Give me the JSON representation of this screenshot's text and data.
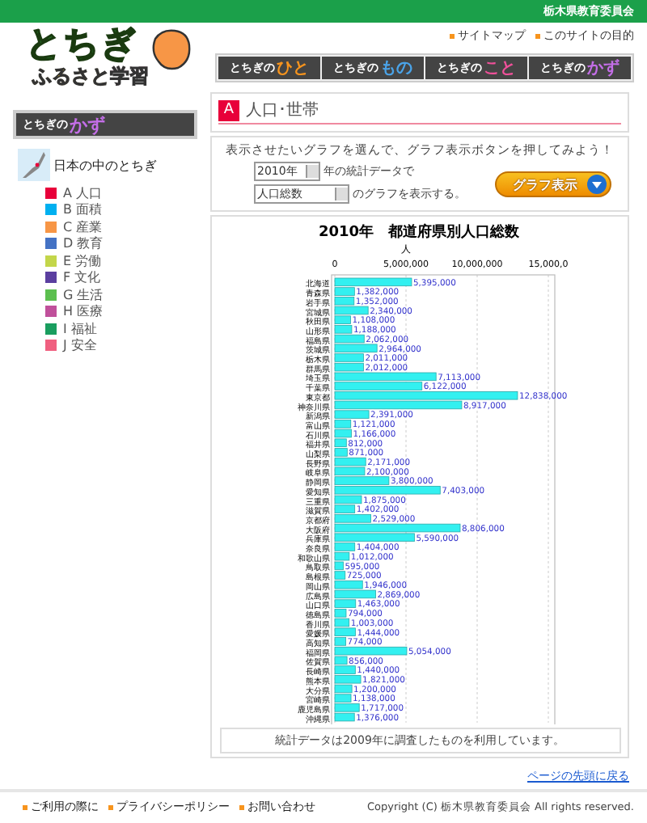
{
  "header": {
    "org": "栃木県教育委員会",
    "logo_top": "とちぎ",
    "logo_bottom_1": "ふるさと",
    "logo_bottom_2": "学習",
    "links": [
      "サイトマップ",
      "このサイトの目的"
    ]
  },
  "nav": [
    {
      "prefix": "とちぎの",
      "word": "ひと"
    },
    {
      "prefix": "とちぎの",
      "word": "もの"
    },
    {
      "prefix": "とちぎの",
      "word": "こと"
    },
    {
      "prefix": "とちぎの",
      "word": "かず"
    }
  ],
  "sidebar": {
    "heading": {
      "prefix": "とちぎの",
      "word": "かず"
    },
    "map_link": "日本の中のとちぎ",
    "categories": [
      {
        "letter": "A",
        "label": "人口",
        "color": "#e8003a"
      },
      {
        "letter": "B",
        "label": "面積",
        "color": "#00b0f0"
      },
      {
        "letter": "C",
        "label": "産業",
        "color": "#f79646"
      },
      {
        "letter": "D",
        "label": "教育",
        "color": "#4472c4"
      },
      {
        "letter": "E",
        "label": "労働",
        "color": "#c3d64a"
      },
      {
        "letter": "F",
        "label": "文化",
        "color": "#5b3fa0"
      },
      {
        "letter": "G",
        "label": "生活",
        "color": "#5cbf4f"
      },
      {
        "letter": "H",
        "label": "医療",
        "color": "#c0509b"
      },
      {
        "letter": "I",
        "label": "福祉",
        "color": "#1a9e5f"
      },
      {
        "letter": "J",
        "label": "安全",
        "color": "#f06080"
      }
    ]
  },
  "section": {
    "letter": "A",
    "title": "人口･世帯",
    "color": "#e8003a"
  },
  "controls": {
    "instruction": "表示させたいグラフを選んで、グラフ表示ボタンを押してみよう！",
    "year": "2010年",
    "year_suffix": "年の統計データで",
    "item": "人口総数",
    "item_suffix": "のグラフを表示する。",
    "button": "グラフ表示"
  },
  "chart_data": {
    "type": "bar",
    "orientation": "horizontal",
    "title": "2010年　都道府県別人口総数",
    "xlabel": "人",
    "data_labels": true,
    "categories": [
      "北海道",
      "青森県",
      "岩手県",
      "宮城県",
      "秋田県",
      "山形県",
      "福島県",
      "茨城県",
      "栃木県",
      "群馬県",
      "埼玉県",
      "千葉県",
      "東京都",
      "神奈川県",
      "新潟県",
      "富山県",
      "石川県",
      "福井県",
      "山梨県",
      "長野県",
      "岐阜県",
      "静岡県",
      "愛知県",
      "三重県",
      "滋賀県",
      "京都府",
      "大阪府",
      "兵庫県",
      "奈良県",
      "和歌山県",
      "鳥取県",
      "島根県",
      "岡山県",
      "広島県",
      "山口県",
      "徳島県",
      "香川県",
      "愛媛県",
      "高知県",
      "福岡県",
      "佐賀県",
      "長崎県",
      "熊本県",
      "大分県",
      "宮崎県",
      "鹿児島県",
      "沖縄県"
    ],
    "values": [
      5395000,
      1382000,
      1352000,
      2340000,
      1108000,
      1188000,
      2062000,
      2964000,
      2011000,
      2012000,
      7113000,
      6122000,
      12838000,
      8917000,
      2391000,
      1121000,
      1166000,
      812000,
      871000,
      2171000,
      2100000,
      3800000,
      7403000,
      1875000,
      1402000,
      2529000,
      8806000,
      5590000,
      1404000,
      1012000,
      595000,
      725000,
      1946000,
      2869000,
      1463000,
      794000,
      1003000,
      1444000,
      774000,
      5054000,
      856000,
      1440000,
      1821000,
      1200000,
      1138000,
      1717000,
      1376000
    ],
    "value_labels": [
      "5,395,000",
      "1,382,000",
      "1,352,000",
      "2,340,000",
      "1,108,000",
      "1,188,000",
      "2,062,000",
      "2,964,000",
      "2,011,000",
      "2,012,000",
      "7,113,000",
      "6,122,000",
      "12,838,000",
      "8,917,000",
      "2,391,000",
      "1,121,000",
      "1,166,000",
      "812,000",
      "871,000",
      "2,171,000",
      "2,100,000",
      "3,800,000",
      "7,403,000",
      "1,875,000",
      "1,402,000",
      "2,529,000",
      "8,806,000",
      "5,590,000",
      "1,404,000",
      "1,012,000",
      "595,000",
      "725,000",
      "1,946,000",
      "2,869,000",
      "1,463,000",
      "794,000",
      "1,003,000",
      "1,444,000",
      "774,000",
      "5,054,000",
      "856,000",
      "1,440,000",
      "1,821,000",
      "1,200,000",
      "1,138,000",
      "1,717,000",
      "1,376,000"
    ],
    "xlim": [
      0,
      15000000
    ],
    "xticks": [
      {
        "value": 0,
        "label": "0"
      },
      {
        "value": 5000000,
        "label": "5,000,000"
      },
      {
        "value": 10000000,
        "label": "10,000,000"
      },
      {
        "value": 15000000,
        "label": "15,000,0"
      }
    ]
  },
  "note": "統計データは2009年に調査したものを利用しています。",
  "back_to_top": "ページの先頭に戻る",
  "footer": {
    "links": [
      "ご利用の際に",
      "プライバシーポリシー",
      "お問い合わせ"
    ],
    "copyright": "Copyright (C) 栃木県教育委員会 All rights reserved."
  }
}
